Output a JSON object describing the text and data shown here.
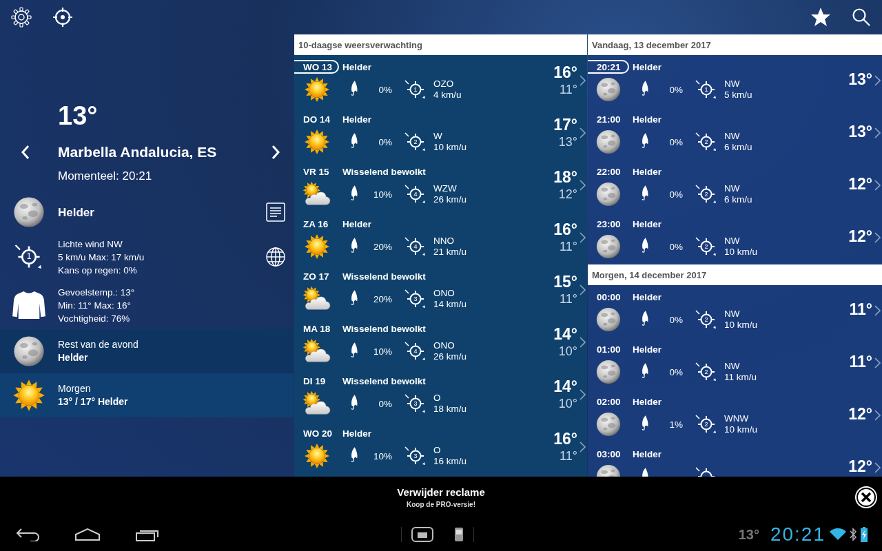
{
  "current": {
    "temperature": "13°",
    "location": "Marbella Andalucia, ES",
    "updated": "Momenteel: 20:21",
    "condition": "Helder",
    "kind": "moon",
    "wind_force": "1",
    "wind_lines": [
      "Lichte wind NW",
      "5 km/u Max: 17 km/u",
      "Kans op regen: 0%"
    ],
    "feel_lines": [
      "Gevoelstemp.: 13°",
      "Min: 11° Max: 16°",
      "Vochtigheid: 76%"
    ]
  },
  "summaries": [
    {
      "title": "Rest van de avond",
      "text": "Helder",
      "kind": "moon"
    },
    {
      "title": "Morgen",
      "text": "13° / 17° Helder",
      "kind": "sun"
    }
  ],
  "daily": {
    "title": "10-daagse weersverwachting",
    "days": [
      {
        "label": "WO 13",
        "current": true,
        "condition": "Helder",
        "kind": "sun",
        "precip": "0%",
        "wind_force": "1",
        "wind_dir": "OZO",
        "wind_speed": "4 km/u",
        "high": "16°",
        "low": "11°"
      },
      {
        "label": "DO 14",
        "current": false,
        "condition": "Helder",
        "kind": "sun",
        "precip": "0%",
        "wind_force": "2",
        "wind_dir": "W",
        "wind_speed": "10 km/u",
        "high": "17°",
        "low": "13°"
      },
      {
        "label": "VR 15",
        "current": false,
        "condition": "Wisselend bewolkt",
        "kind": "cloudy",
        "precip": "10%",
        "wind_force": "4",
        "wind_dir": "WZW",
        "wind_speed": "26 km/u",
        "high": "18°",
        "low": "12°"
      },
      {
        "label": "ZA 16",
        "current": false,
        "condition": "Helder",
        "kind": "sun",
        "precip": "20%",
        "wind_force": "4",
        "wind_dir": "NNO",
        "wind_speed": "21 km/u",
        "high": "16°",
        "low": "11°"
      },
      {
        "label": "ZO 17",
        "current": false,
        "condition": "Wisselend bewolkt",
        "kind": "cloudy",
        "precip": "20%",
        "wind_force": "3",
        "wind_dir": "ONO",
        "wind_speed": "14 km/u",
        "high": "15°",
        "low": "11°"
      },
      {
        "label": "MA 18",
        "current": false,
        "condition": "Wisselend bewolkt",
        "kind": "cloudy",
        "precip": "10%",
        "wind_force": "4",
        "wind_dir": "ONO",
        "wind_speed": "26 km/u",
        "high": "14°",
        "low": "10°"
      },
      {
        "label": "DI 19",
        "current": false,
        "condition": "Wisselend bewolkt",
        "kind": "cloudy",
        "precip": "0%",
        "wind_force": "3",
        "wind_dir": "O",
        "wind_speed": "18 km/u",
        "high": "14°",
        "low": "10°"
      },
      {
        "label": "WO 20",
        "current": false,
        "condition": "Helder",
        "kind": "sun",
        "precip": "10%",
        "wind_force": "3",
        "wind_dir": "O",
        "wind_speed": "16 km/u",
        "high": "16°",
        "low": "11°"
      }
    ]
  },
  "hourly": [
    {
      "title": "Vandaag, 13 december 2017",
      "hours": [
        {
          "label": "20:21",
          "current": true,
          "condition": "Helder",
          "kind": "moon",
          "precip": "0%",
          "wind_force": "1",
          "wind_dir": "NW",
          "wind_speed": "5 km/u",
          "high": "13°"
        },
        {
          "label": "21:00",
          "current": false,
          "condition": "Helder",
          "kind": "moon",
          "precip": "0%",
          "wind_force": "2",
          "wind_dir": "NW",
          "wind_speed": "6 km/u",
          "high": "13°"
        },
        {
          "label": "22:00",
          "current": false,
          "condition": "Helder",
          "kind": "moon",
          "precip": "0%",
          "wind_force": "2",
          "wind_dir": "NW",
          "wind_speed": "6 km/u",
          "high": "12°"
        },
        {
          "label": "23:00",
          "current": false,
          "condition": "Helder",
          "kind": "moon",
          "precip": "0%",
          "wind_force": "2",
          "wind_dir": "NW",
          "wind_speed": "10 km/u",
          "high": "12°"
        }
      ]
    },
    {
      "title": "Morgen, 14 december 2017",
      "hours": [
        {
          "label": "00:00",
          "current": false,
          "condition": "Helder",
          "kind": "moon",
          "precip": "0%",
          "wind_force": "2",
          "wind_dir": "NW",
          "wind_speed": "10 km/u",
          "high": "11°"
        },
        {
          "label": "01:00",
          "current": false,
          "condition": "Helder",
          "kind": "moon",
          "precip": "0%",
          "wind_force": "2",
          "wind_dir": "NW",
          "wind_speed": "11 km/u",
          "high": "11°"
        },
        {
          "label": "02:00",
          "current": false,
          "condition": "Helder",
          "kind": "moon",
          "precip": "1%",
          "wind_force": "2",
          "wind_dir": "WNW",
          "wind_speed": "10 km/u",
          "high": "12°"
        },
        {
          "label": "03:00",
          "current": false,
          "condition": "Helder",
          "kind": "moon",
          "high": "12°"
        }
      ]
    }
  ],
  "ad": {
    "title": "Verwijder reclame",
    "subtitle": "Koop de PRO-versie!"
  },
  "status_bar": {
    "temperature": "13°",
    "time": "20:21"
  }
}
